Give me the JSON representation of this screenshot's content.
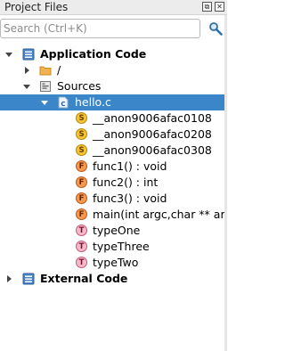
{
  "panel": {
    "title": "Project Files",
    "restore_glyph": "⧉",
    "close_glyph": "✕"
  },
  "search": {
    "placeholder": "Search (Ctrl+K)",
    "value": ""
  },
  "tree": {
    "application_code": "Application Code",
    "root_folder": "/",
    "sources": "Sources",
    "file": "hello.c",
    "symbols": [
      {
        "kind": "S",
        "label": "__anon9006afac0108"
      },
      {
        "kind": "S",
        "label": "__anon9006afac0208"
      },
      {
        "kind": "S",
        "label": "__anon9006afac0308"
      },
      {
        "kind": "F",
        "label": "func1() : void"
      },
      {
        "kind": "F",
        "label": "func2() : int"
      },
      {
        "kind": "F",
        "label": "func3() : void"
      },
      {
        "kind": "F",
        "label": "main(int argc,char ** argv) : int"
      },
      {
        "kind": "T",
        "label": "typeOne"
      },
      {
        "kind": "T",
        "label": "typeThree"
      },
      {
        "kind": "T",
        "label": "typeTwo"
      }
    ],
    "external_code": "External Code"
  },
  "colors": {
    "selection": "#3a86c8",
    "struct_badge": "#f3c530",
    "function_badge": "#f39a50",
    "type_badge": "#f7b8c7"
  }
}
